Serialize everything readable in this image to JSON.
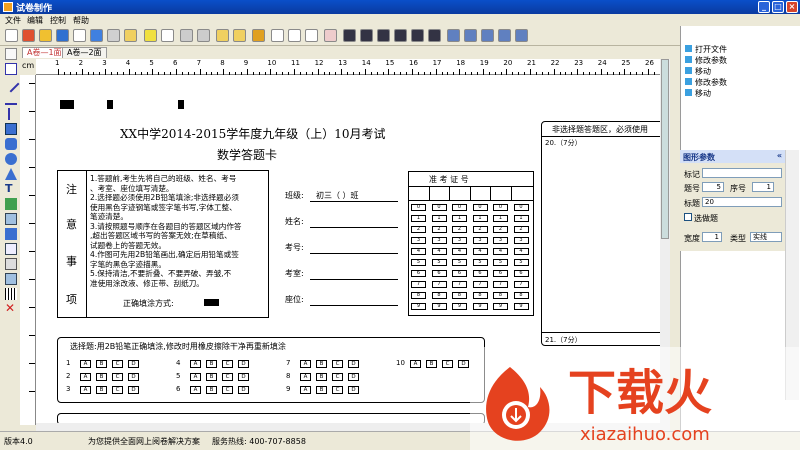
{
  "window": {
    "title": "试卷制作",
    "min": "_",
    "max": "□",
    "close": "×"
  },
  "menu": [
    "文件",
    "编辑",
    "控制",
    "帮助"
  ],
  "tabs": [
    "A卷—1面",
    "A卷—2面"
  ],
  "ruler": {
    "unit": "cm",
    "ticks": [
      "1",
      "2",
      "3",
      "4",
      "5",
      "6",
      "7",
      "8",
      "9",
      "10",
      "11",
      "12",
      "13",
      "14",
      "15",
      "16",
      "17",
      "18",
      "19",
      "20",
      "21",
      "22",
      "23",
      "24",
      "25",
      "26"
    ]
  },
  "right_panel": {
    "items": [
      "打开文件",
      "修改参数",
      "移动",
      "修改参数",
      "移动"
    ]
  },
  "shape_params": {
    "title": "图形参数",
    "collapse": "«",
    "mark_label": "标记",
    "mark_value": "",
    "qno_label": "题号",
    "qno_value": "5",
    "seq_label": "序号",
    "seq_value": "1",
    "title_label": "标题",
    "title_value": "20",
    "optional_label": "选做题",
    "width_label": "宽度",
    "width_value": "1",
    "type_label": "类型",
    "type_value": "实线"
  },
  "sheet": {
    "title": "XX中学2014-2015学年度九年级（上）10月考试",
    "subtitle": "数学答题卡",
    "notice_chars": [
      "注",
      "意",
      "事",
      "项"
    ],
    "notice_text": "1.答题前,考生先将自己的班级、姓名、考号\n、考室、座位填写清楚。\n2.选择题必须使用2B铅笔填涂;非选择题必须\n使用黑色字迹钢笔或签字笔书写,字体工整、\n笔迹清楚。\n3.请按照题号顺序在各题目的答题区域内作答\n,超出答题区域书写的答案无效;在草稿纸、\n试题卷上的答题无效。\n4.作图可先用2B铅笔画出,确定后用铅笔或签\n字笔的黑色字迹描黑。\n5.保持清洁,不要折叠、不要弄破、弄皱,不\n准使用涂改液、修正带、刮纸刀。",
    "fill_method": "正确填涂方式:",
    "info_fields": [
      {
        "label": "班级:",
        "value": "初三（   ）班"
      },
      {
        "label": "姓名:",
        "value": ""
      },
      {
        "label": "考号:",
        "value": ""
      },
      {
        "label": "考室:",
        "value": ""
      },
      {
        "label": "座位:",
        "value": ""
      }
    ],
    "zkz_title": "准 考 证 号",
    "zkz_digits": [
      "0",
      "1",
      "2",
      "3",
      "4",
      "5",
      "6",
      "7",
      "8",
      "9"
    ],
    "nonchoice_title": "非选择题答题区，必须使用",
    "q20": "20.（7分）",
    "q21": "21.（7分）",
    "choice_title": "选择题:用2B铅笔正确填涂,修改时用橡皮擦除干净再重新填涂",
    "choice_rows": [
      [
        "1",
        "4",
        "7",
        "10"
      ],
      [
        "2",
        "5",
        "8"
      ],
      [
        "3",
        "6",
        "9"
      ]
    ],
    "options": [
      "A",
      "B",
      "C",
      "D"
    ]
  },
  "status": {
    "version": "版本4.0",
    "slogan": "为您提供全面网上阅卷解决方案",
    "hotline": "服务热线: 400-707-8858"
  },
  "watermark": {
    "text": "下载火",
    "url": "xiazaihuo.com"
  },
  "colors": {
    "title_bar": "#0a4fc9",
    "accent": "#e5421f",
    "tab_active": "#c03030"
  }
}
